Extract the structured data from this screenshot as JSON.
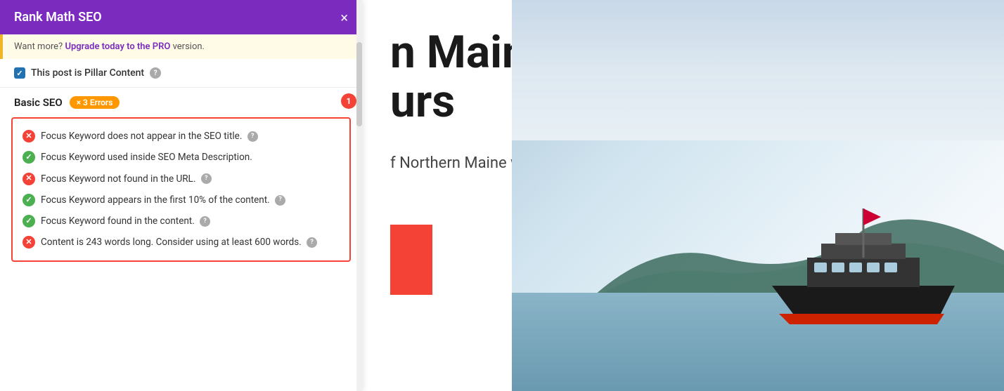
{
  "panel": {
    "header": {
      "title": "Rank Math SEO",
      "close_label": "×"
    },
    "upgrade_banner": {
      "text_before": "Want more?",
      "link_text": "Upgrade today to the PRO",
      "text_after": "version."
    },
    "pillar": {
      "label": "This post is Pillar Content",
      "help": "?"
    },
    "basic_seo": {
      "title": "Basic SEO",
      "errors_label": "× 3 Errors",
      "notification": "1"
    },
    "checklist": {
      "items": [
        {
          "status": "error",
          "text": "Focus Keyword does not appear in the SEO title.",
          "has_help": true
        },
        {
          "status": "success",
          "text": "Focus Keyword used inside SEO Meta Description.",
          "has_help": false
        },
        {
          "status": "error",
          "text": "Focus Keyword not found in the URL.",
          "has_help": true
        },
        {
          "status": "success",
          "text": "Focus Keyword appears in the first 10% of the content.",
          "has_help": true
        },
        {
          "status": "success",
          "text": "Focus Keyword found in the content.",
          "has_help": true
        },
        {
          "status": "error",
          "text": "Content is 243 words long. Consider using at least 600 words.",
          "has_help": true
        }
      ]
    }
  },
  "content": {
    "heading_line1": "n Maine",
    "heading_line2": "urs",
    "subheading": "f Northern Maine with Seagate"
  },
  "icons": {
    "check": "✓",
    "cross": "✕",
    "close": "×",
    "help": "?"
  }
}
